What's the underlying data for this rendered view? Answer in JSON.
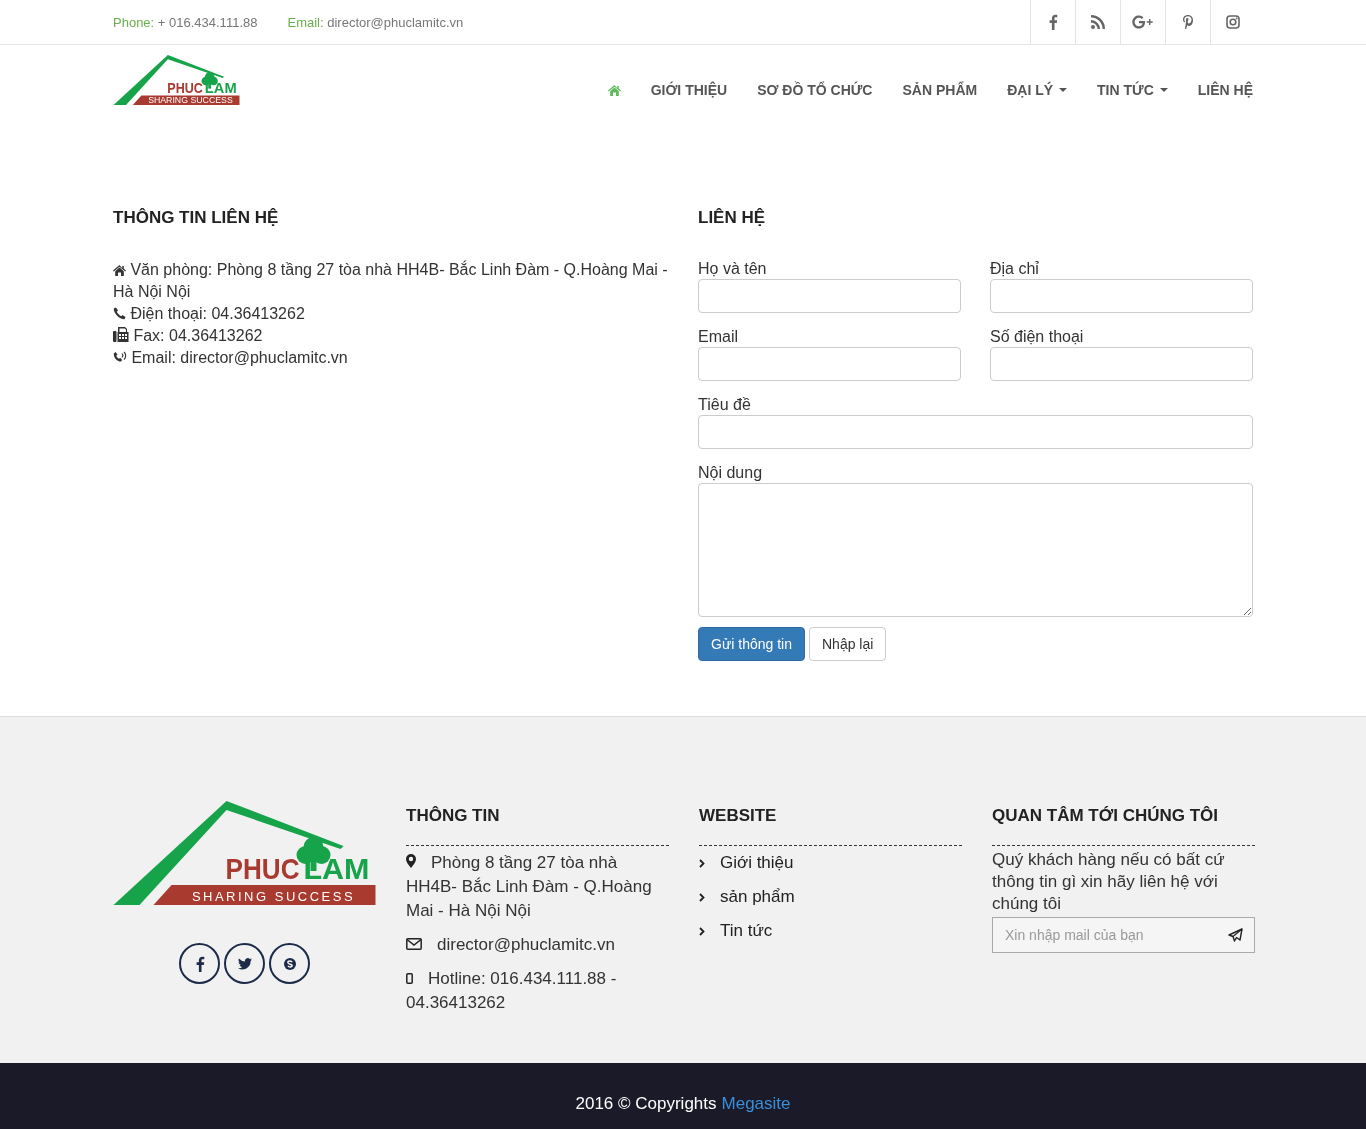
{
  "top_bar": {
    "phone_label": "Phone:",
    "phone": "+ 016.434.111.88",
    "email_label": "Email:",
    "email": "director@phuclamitc.vn"
  },
  "header": {
    "logo": {
      "word_1": "PHUC",
      "word_2": "LAM",
      "tagline": "SHARING SUCCESS"
    },
    "nav": [
      {
        "kind": "home",
        "selected": true
      },
      {
        "kind": "text",
        "label": "GIỚI THIỆU",
        "dropdown": false,
        "selected": false
      },
      {
        "kind": "text",
        "label": "SƠ ĐỒ TỔ CHỨC",
        "dropdown": false,
        "selected": false
      },
      {
        "kind": "text",
        "label": "SẢN PHẨM",
        "dropdown": false,
        "selected": false
      },
      {
        "kind": "text",
        "label": "ĐẠI LÝ",
        "dropdown": true,
        "selected": false
      },
      {
        "kind": "text",
        "label": "TIN TỨC",
        "dropdown": true,
        "selected": false
      },
      {
        "kind": "text",
        "label": "LIÊN HỆ",
        "dropdown": false,
        "selected": false
      }
    ]
  },
  "contact_info": {
    "title": "THÔNG TIN LIÊN HỆ",
    "lines": [
      {
        "kind": "address",
        "text": "Văn phòng: Phòng 8 tầng 27 tòa nhà HH4B- Bắc Linh Đàm - Q.Hoàng Mai - Hà Nội Nội"
      },
      {
        "kind": "phone",
        "text": "Điện thoại: 04.36413262"
      },
      {
        "kind": "fax",
        "text": "Fax: 04.36413262"
      },
      {
        "kind": "email",
        "text": "Email: director@phuclamitc.vn"
      }
    ]
  },
  "contact_form": {
    "title": "LIÊN HỆ",
    "fields": [
      {
        "kind": "half",
        "label": "Họ và tên"
      },
      {
        "kind": "half",
        "label": "Địa chỉ"
      },
      {
        "kind": "half",
        "label": "Email"
      },
      {
        "kind": "half",
        "label": "Số điện thoại"
      },
      {
        "kind": "full",
        "label": "Tiêu đề"
      },
      {
        "kind": "textarea",
        "label": "Nội dung"
      }
    ],
    "buttons": [
      {
        "kind": "primary",
        "label": "Gửi thông tin"
      },
      {
        "kind": "default",
        "label": "Nhập lại"
      }
    ]
  },
  "footer": {
    "logo": {
      "word_1": "PHUC",
      "word_2": "LAM",
      "tagline": "SHARING SUCCESS"
    },
    "info": {
      "title": "THÔNG TIN",
      "items": [
        {
          "kind": "location",
          "text": "Phòng 8 tầng 27 tòa nhà HH4B- Bắc Linh Đàm - Q.Hoàng Mai - Hà Nội Nội"
        },
        {
          "kind": "email",
          "text": "director@phuclamitc.vn"
        },
        {
          "kind": "mobile",
          "text": "Hotline: 016.434.111.88 - 04.36413262"
        }
      ]
    },
    "website": {
      "title": "WEBSITE",
      "links": [
        "Giới thiệu",
        "sản phẩm",
        "Tin tức"
      ]
    },
    "newsletter": {
      "title": "QUAN TÂM TỚI CHÚNG TÔI",
      "text": "Quý khách hàng nếu có bất cứ thông tin gì xin hãy liên hệ với chúng tôi",
      "placeholder": "Xin nhập mail của bạn"
    }
  },
  "copyright": {
    "text": "2016 © Copyrights",
    "link": "Megasite"
  }
}
